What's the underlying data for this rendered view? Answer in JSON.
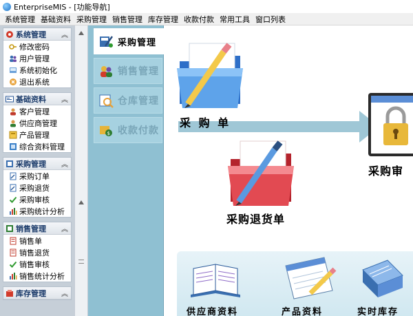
{
  "window": {
    "title": "EnterpriseMIS - [功能导航]"
  },
  "menu": [
    "系统管理",
    "基础资料",
    "采购管理",
    "销售管理",
    "库存管理",
    "收款付款",
    "常用工具",
    "窗口列表"
  ],
  "sidebar": {
    "groups": [
      {
        "title": "系统管理",
        "icon": "system-gear-icon",
        "items": [
          {
            "label": "修改密码",
            "icon": "key-icon"
          },
          {
            "label": "用户管理",
            "icon": "users-icon"
          },
          {
            "label": "系统初始化",
            "icon": "init-icon"
          },
          {
            "label": "退出系统",
            "icon": "exit-icon"
          }
        ]
      },
      {
        "title": "基础资料",
        "icon": "card-icon",
        "items": [
          {
            "label": "客户管理",
            "icon": "customer-icon"
          },
          {
            "label": "供应商管理",
            "icon": "supplier-icon"
          },
          {
            "label": "产品管理",
            "icon": "product-icon"
          },
          {
            "label": "综合资料管理",
            "icon": "data-icon"
          }
        ]
      },
      {
        "title": "采购管理",
        "icon": "purchase-icon",
        "items": [
          {
            "label": "采购订单",
            "icon": "doc-icon"
          },
          {
            "label": "采购退货",
            "icon": "doc-icon"
          },
          {
            "label": "采购审核",
            "icon": "check-icon"
          },
          {
            "label": "采购统计分析",
            "icon": "stats-icon"
          }
        ]
      },
      {
        "title": "销售管理",
        "icon": "sales-icon",
        "items": [
          {
            "label": "销售单",
            "icon": "doc-icon"
          },
          {
            "label": "销售退货",
            "icon": "doc-icon"
          },
          {
            "label": "销售审核",
            "icon": "check-icon"
          },
          {
            "label": "销售统计分析",
            "icon": "stats-icon"
          }
        ]
      },
      {
        "title": "库存管理",
        "icon": "inventory-icon",
        "items": []
      }
    ]
  },
  "nav_tabs": [
    {
      "label": "采购管理",
      "icon": "purchase-icon",
      "active": true
    },
    {
      "label": "销售管理",
      "icon": "sales-icon",
      "active": false
    },
    {
      "label": "仓库管理",
      "icon": "warehouse-icon",
      "active": false
    },
    {
      "label": "收款付款",
      "icon": "payment-icon",
      "active": false
    }
  ],
  "content": {
    "purchase_order_label": "采 购 单",
    "purchase_return_label": "采购退货单",
    "purchase_audit_label": "采购审",
    "supplier_label": "供应商资料",
    "product_label": "产品资料",
    "stock_label": "实时库存"
  },
  "colors": {
    "nav_panel": "#8fc0d2",
    "arrow": "#9fc7d6",
    "sidebar_bg": "#c6cfd8",
    "group_title": "#1a3a6a"
  }
}
